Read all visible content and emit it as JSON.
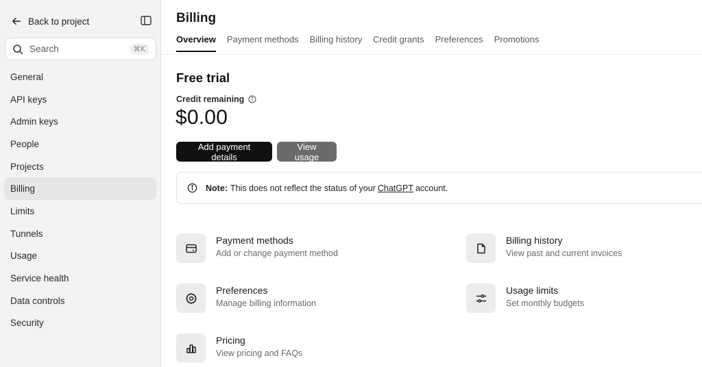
{
  "sidebar": {
    "back_label": "Back to project",
    "search_placeholder": "Search",
    "search_shortcut": "⌘K",
    "items": [
      {
        "label": "General"
      },
      {
        "label": "API keys"
      },
      {
        "label": "Admin keys"
      },
      {
        "label": "People"
      },
      {
        "label": "Projects"
      },
      {
        "label": "Billing",
        "active": true
      },
      {
        "label": "Limits"
      },
      {
        "label": "Tunnels"
      },
      {
        "label": "Usage"
      },
      {
        "label": "Service health"
      },
      {
        "label": "Data controls"
      },
      {
        "label": "Security"
      }
    ]
  },
  "main": {
    "title": "Billing",
    "tabs": [
      {
        "label": "Overview",
        "active": true
      },
      {
        "label": "Payment methods"
      },
      {
        "label": "Billing history"
      },
      {
        "label": "Credit grants"
      },
      {
        "label": "Preferences"
      },
      {
        "label": "Promotions"
      }
    ],
    "plan_title": "Free trial",
    "credit_label": "Credit remaining",
    "credit_value": "$0.00",
    "add_payment_label": "Add payment details",
    "view_usage_label": "View usage",
    "note": {
      "prefix": "Note:",
      "text_before": "This does not reflect the status of your",
      "link": "ChatGPT",
      "text_after": "account."
    },
    "cards": [
      {
        "title": "Payment methods",
        "desc": "Add or change payment method",
        "icon": "credit-card-icon"
      },
      {
        "title": "Billing history",
        "desc": "View past and current invoices",
        "icon": "document-icon"
      },
      {
        "title": "Preferences",
        "desc": "Manage billing information",
        "icon": "gear-icon"
      },
      {
        "title": "Usage limits",
        "desc": "Set monthly budgets",
        "icon": "sliders-icon"
      },
      {
        "title": "Pricing",
        "desc": "View pricing and FAQs",
        "icon": "bar-chart-icon"
      }
    ]
  }
}
